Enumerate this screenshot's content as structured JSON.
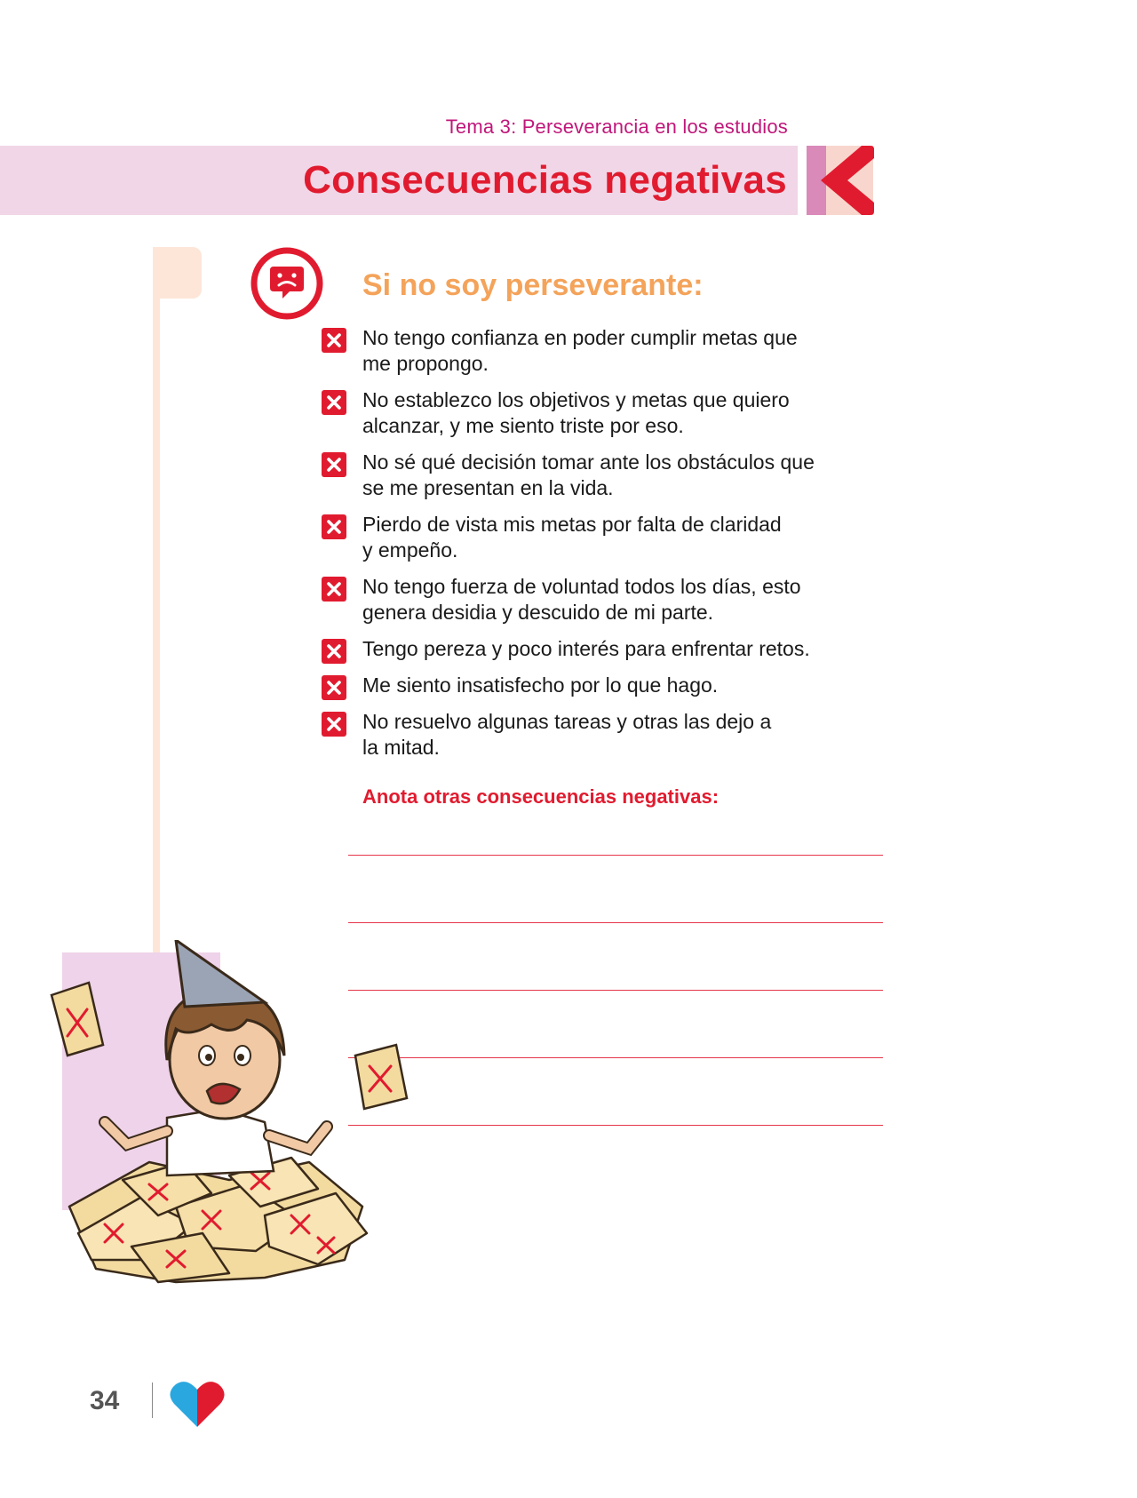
{
  "header": {
    "topic": "Tema 3: Perseverancia en los estudios",
    "title": "Consecuencias negativas"
  },
  "section": {
    "icon": "sad-face-speech-bubble-icon",
    "heading": "Si no soy perseverante:",
    "items": [
      {
        "lines": [
          "No tengo confianza en poder cumplir metas que",
          "me propongo."
        ]
      },
      {
        "lines": [
          "No establezco los objetivos y metas que quiero",
          "alcanzar, y me siento triste por eso."
        ]
      },
      {
        "lines": [
          "No sé qué decisión tomar ante los obstáculos que",
          "se me presentan en la vida."
        ]
      },
      {
        "lines": [
          "Pierdo de vista mis metas por falta de claridad",
          "y empeño."
        ]
      },
      {
        "lines": [
          "No tengo fuerza de voluntad todos los días, esto",
          "genera desidia y descuido de mi parte."
        ]
      },
      {
        "lines": [
          "Tengo pereza y poco interés para enfrentar retos."
        ]
      },
      {
        "lines": [
          "Me siento insatisfecho por lo que hago."
        ]
      },
      {
        "lines": [
          "No resuelvo algunas tareas y otras las dejo a",
          "la mitad."
        ]
      }
    ],
    "bullet_icon": "red-x-icon",
    "prompt": "Anota otras consecuencias negativas:",
    "answer_line_count": 5
  },
  "footer": {
    "page_number": "34",
    "logo_icon": "heart-logo-icon"
  },
  "colors": {
    "topic": "#c0177a",
    "title": "#e11b2f",
    "band": "#f1d6e7",
    "subheading": "#f4a35a",
    "accent_red": "#e11b2f"
  }
}
